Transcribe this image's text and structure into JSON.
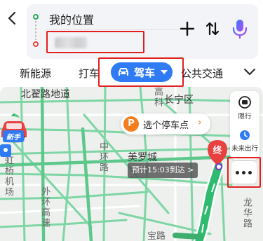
{
  "route": {
    "origin": "我的位置",
    "destination": ""
  },
  "icons": {
    "back": "chevron-left-icon",
    "add": "plus-icon",
    "swap": "swap-icon",
    "voice": "microphone-icon",
    "car": "car-icon",
    "more_tabs": "chevron-down-icon",
    "parking": "parking-icon",
    "limit": "traffic-limit-icon",
    "future": "clock-icon",
    "more": "more-dots-icon",
    "end": "end-pin-icon",
    "start": "start-car-icon"
  },
  "tabs": {
    "new_energy": "新能源",
    "taxi": "打车",
    "drive": "驾车",
    "transit": "公共交通"
  },
  "map": {
    "labels": {
      "beijing_rd": "北翟路地道",
      "changning": "长宁区",
      "gaoke": "高科",
      "zhonghuan": "中环路",
      "meiluo": "美罗城",
      "honghuaqiao": "虹桥机场",
      "waihuan": "外环高速",
      "longhua": "龙华路",
      "qiqiao": "宝路"
    },
    "parking_chip": "选个停车点",
    "parking_arrow": "›",
    "eta": "预计15:03到达 >",
    "end_label": "终",
    "newbie": "新手"
  },
  "side_tools": {
    "limit": "限行",
    "future": "未来出行"
  },
  "colors": {
    "accent_blue": "#2f7bf5",
    "highlight_red": "#e21f1f",
    "route_green": "#2fbb6f",
    "road_green": "#7dd6a4",
    "end_red": "#e8413f",
    "parking_orange": "#f47d20"
  }
}
